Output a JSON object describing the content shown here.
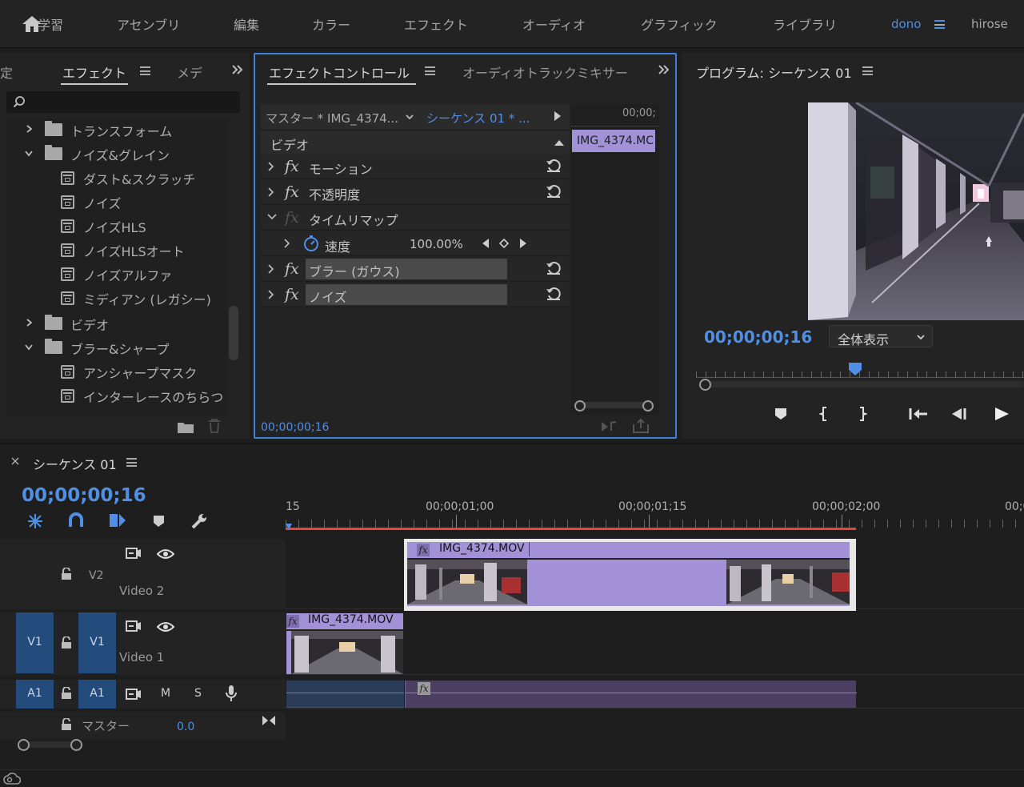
{
  "workspaces": [
    {
      "label": "学習",
      "active": false
    },
    {
      "label": "アセンブリ",
      "active": false
    },
    {
      "label": "編集",
      "active": false
    },
    {
      "label": "カラー",
      "active": false
    },
    {
      "label": "エフェクト",
      "active": false
    },
    {
      "label": "オーディオ",
      "active": false
    },
    {
      "label": "グラフィック",
      "active": false
    },
    {
      "label": "ライブラリ",
      "active": false
    },
    {
      "label": "dono",
      "active": true
    },
    {
      "label": "hirose",
      "active": false
    }
  ],
  "effects_panel": {
    "prev_tab": "定",
    "title": "エフェクト",
    "next_tab": "メデ",
    "search_placeholder": "",
    "tree": [
      {
        "label": "トランスフォーム",
        "type": "folder",
        "expanded": false
      },
      {
        "label": "ノイズ&グレイン",
        "type": "folder",
        "expanded": true
      },
      {
        "label": "ダスト&スクラッチ",
        "type": "effect"
      },
      {
        "label": "ノイズ",
        "type": "effect"
      },
      {
        "label": "ノイズHLS",
        "type": "effect"
      },
      {
        "label": "ノイズHLSオート",
        "type": "effect"
      },
      {
        "label": "ノイズアルファ",
        "type": "effect"
      },
      {
        "label": "ミディアン (レガシー)",
        "type": "effect"
      },
      {
        "label": "ビデオ",
        "type": "folder",
        "expanded": false
      },
      {
        "label": "ブラー&シャープ",
        "type": "folder",
        "expanded": true
      },
      {
        "label": "アンシャープマスク",
        "type": "effect"
      },
      {
        "label": "インターレースのちらつ",
        "type": "effect"
      }
    ]
  },
  "effect_controls": {
    "title": "エフェクトコントロール",
    "tab2": "オーディオトラックミキサー",
    "master_label": "マスター * IMG_4374...",
    "sequence_label": "シーケンス 01 * ...",
    "ruler_time": "00;00;",
    "clip_label": "IMG_4374.MC",
    "section": "ビデオ",
    "rows": [
      {
        "name": "モーション",
        "fx": "fx",
        "expand": "right",
        "reset": true
      },
      {
        "name": "不透明度",
        "fx": "fx",
        "expand": "right",
        "reset": true
      },
      {
        "name": "タイムリマップ",
        "fx": "fx",
        "expand": "down",
        "reset": false
      },
      {
        "name": "ブラー (ガウス)",
        "fx": "fx",
        "expand": "right",
        "reset": true
      },
      {
        "name": "ノイズ",
        "fx": "fx",
        "expand": "right",
        "reset": true
      }
    ],
    "speed_label": "速度",
    "speed_value": "100.00%",
    "timecode": "00;00;00;16"
  },
  "program_monitor": {
    "title": "プログラム: シーケンス 01",
    "timecode": "00;00;00;16",
    "fit_label": "全体表示"
  },
  "timeline": {
    "title": "シーケンス 01",
    "timecode": "00;00;00;16",
    "ruler_labels": [
      "15",
      "00;00;01;00",
      "00;00;01;15",
      "00;00;02;00",
      "00;0"
    ],
    "tracks": {
      "v2": {
        "name": "V2",
        "label": "Video 2"
      },
      "v1": {
        "src": "V1",
        "name": "V1",
        "label": "Video 1"
      },
      "a1": {
        "src": "A1",
        "name": "A1",
        "m": "M",
        "s": "S"
      },
      "master": {
        "label": "マスター",
        "value": "0.0"
      }
    },
    "clips": {
      "v2_clip": "IMG_4374.MOV",
      "v1_clip": "IMG_4374.MOV",
      "fx_badge": "fx"
    }
  },
  "colors": {
    "accent_blue": "#4f8fe6",
    "clip_purple": "#a391d8",
    "playhead_red": "#e8453c",
    "track_button_blue": "#234c7c"
  }
}
